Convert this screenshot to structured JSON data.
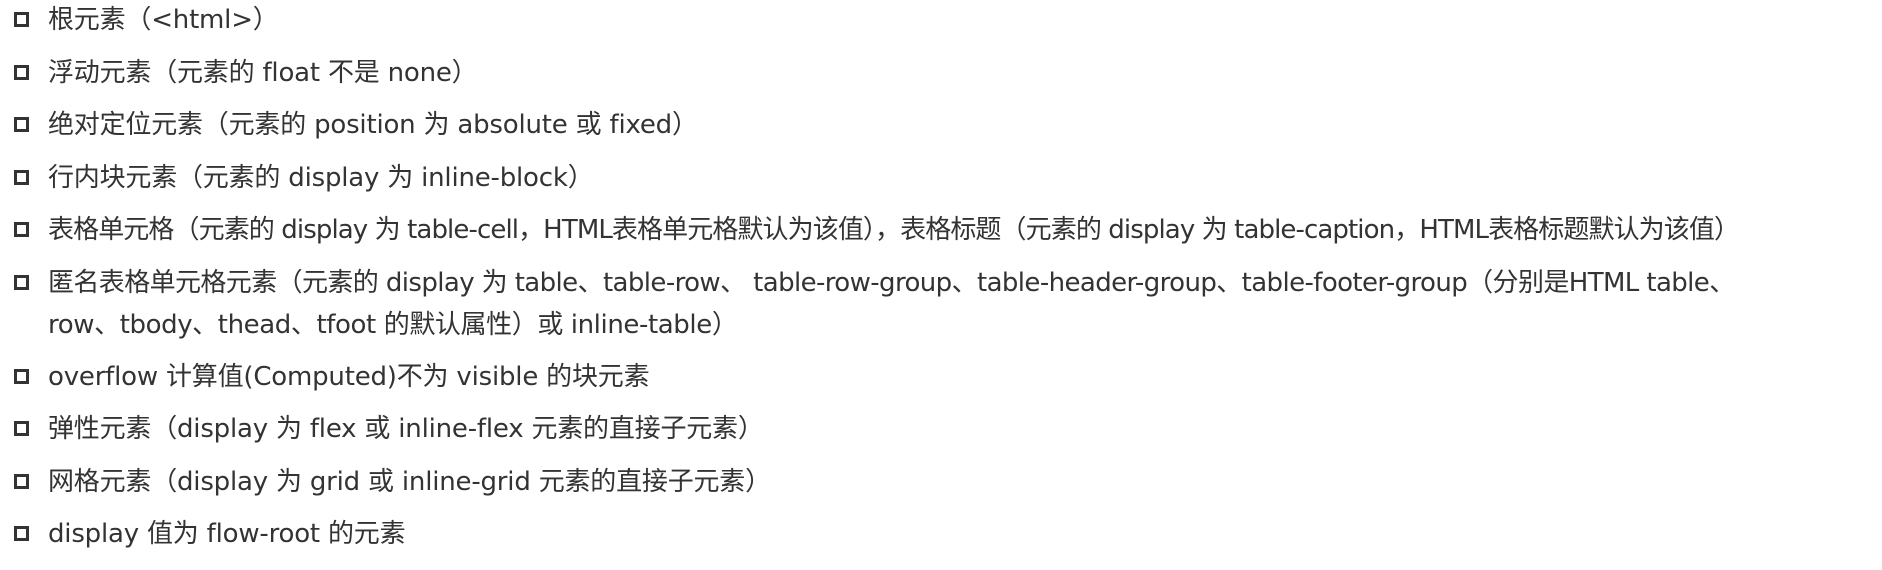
{
  "items": [
    "根元素（<html>）",
    "浮动元素（元素的 float 不是 none）",
    "绝对定位元素（元素的 position 为 absolute 或 fixed）",
    "行内块元素（元素的 display 为 inline-block）",
    "表格单元格（元素的 display 为 table-cell，HTML表格单元格默认为该值），表格标题（元素的 display 为 table-caption，HTML表格标题默认为该值）",
    "匿名表格单元格元素（元素的 display 为 table、table-row、 table-row-group、table-header-group、table-footer-group（分别是HTML table、",
    "row、tbody、thead、tfoot 的默认属性）或 inline-table）",
    "overflow 计算值(Computed)不为 visible 的块元素",
    "弹性元素（display 为 flex 或 inline-flex 元素的直接子元素）",
    "网格元素（display 为 grid 或 inline-grid 元素的直接子元素）",
    "display 值为 flow-root 的元素"
  ]
}
